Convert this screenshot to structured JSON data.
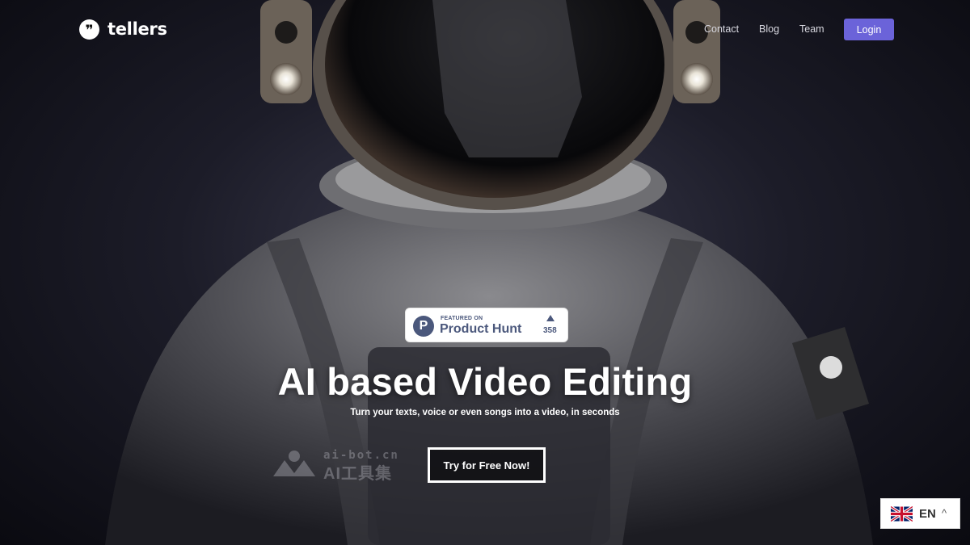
{
  "brand": {
    "name": "tellers",
    "mark": "❞"
  },
  "nav": {
    "contact": "Contact",
    "blog": "Blog",
    "team": "Team",
    "login": "Login"
  },
  "badge": {
    "letter": "P",
    "featured": "FEATURED ON",
    "name": "Product Hunt",
    "count": "358"
  },
  "hero": {
    "title": "AI based Video Editing",
    "subtitle": "Turn your texts, voice or even songs into a video, in seconds",
    "cta": "Try for Free Now!"
  },
  "watermark": {
    "domain": "ai-bot.cn",
    "label": "AI工具集"
  },
  "language": {
    "code": "EN",
    "chevron": "^"
  },
  "colors": {
    "accent": "#6b63d9",
    "product_hunt": "#4b587c"
  }
}
